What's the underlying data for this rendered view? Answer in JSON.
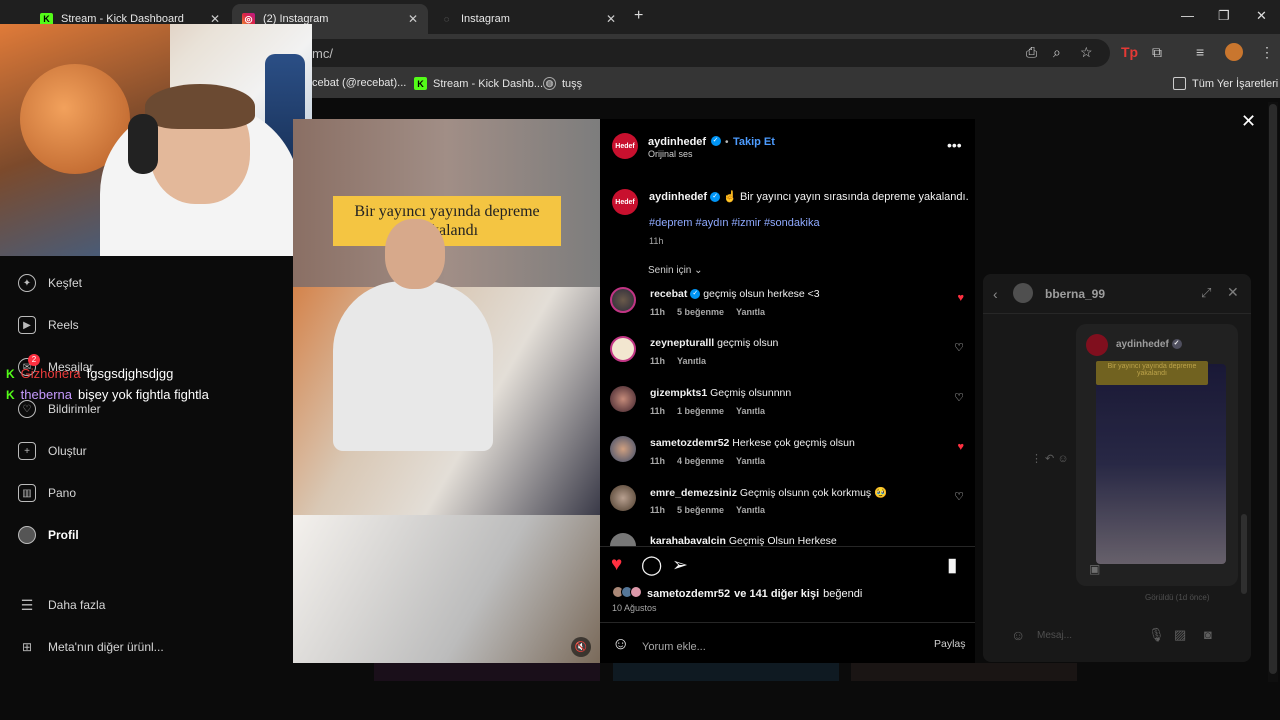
{
  "browser": {
    "tabs": [
      {
        "label": "Stream - Kick Dashboard",
        "favicon": "K"
      },
      {
        "label": "(2) Instagram",
        "favicon": "instagram-icon"
      },
      {
        "label": "Instagram",
        "favicon": "loading-icon"
      }
    ],
    "new_tab": "+",
    "url": "mc/",
    "bookmarks": [
      {
        "label": "cebat (@recebat)..."
      },
      {
        "label": "Stream - Kick Dashb..."
      },
      {
        "label": "tuşş"
      }
    ],
    "all_bookmarks": "Tüm Yer İşaretleri"
  },
  "nav": {
    "items": [
      {
        "label": "Keşfet",
        "icon": "compass-icon"
      },
      {
        "label": "Reels",
        "icon": "reels-icon"
      },
      {
        "label": "Mesajlar",
        "icon": "messenger-icon",
        "badge": "2"
      },
      {
        "label": "Bildirimler",
        "icon": "heart-icon"
      },
      {
        "label": "Oluştur",
        "icon": "plus-icon"
      },
      {
        "label": "Pano",
        "icon": "dashboard-icon"
      },
      {
        "label": "Profil",
        "icon": "profile-avatar"
      },
      {
        "label": "Daha fazla",
        "icon": "menu-icon"
      },
      {
        "label": "Meta'nın diğer ürünl...",
        "icon": "apps-icon"
      }
    ]
  },
  "chat": [
    {
      "user": "Gizhonera",
      "message": "fgsgsdjghsdjgg"
    },
    {
      "user": "theberna",
      "message": "bişey yok fightla fightla"
    }
  ],
  "video": {
    "caption": "Bir yayıncı yayında depreme yakalandı"
  },
  "post": {
    "author": "aydinhedef",
    "author_badge": "Hedef",
    "follow": "Takip Et",
    "audio": "Orijinal ses",
    "description_author": "aydinhedef",
    "description": "Bir yayıncı yayın sırasında depreme yakalandı.",
    "hashtags": "#deprem #aydın #izmir #sondakika",
    "time": "11h",
    "sort": "Senin için",
    "comments": [
      {
        "user": "recebat",
        "text": "geçmiş olsun herkese <3",
        "time": "11h",
        "likes": "5 beğenme",
        "reply": "Yanıtla",
        "liked": true
      },
      {
        "user": "zeynepturalll",
        "text": "geçmiş olsun",
        "time": "11h",
        "likes": "",
        "reply": "Yanıtla",
        "liked": false
      },
      {
        "user": "gizempkts1",
        "text": "Geçmiş olsunnnn",
        "time": "11h",
        "likes": "1 beğenme",
        "reply": "Yanıtla",
        "liked": false
      },
      {
        "user": "sametozdemr52",
        "text": "Herkese çok geçmiş olsun",
        "time": "11h",
        "likes": "4 beğenme",
        "reply": "Yanıtla",
        "liked": true
      },
      {
        "user": "emre_demezsiniz",
        "text": "Geçmiş olsunn çok korkmuş 🥹",
        "time": "11h",
        "likes": "5 beğenme",
        "reply": "Yanıtla",
        "liked": false
      },
      {
        "user": "karahabavalcin",
        "text": "Geçmiş Olsun Herkese",
        "time": "",
        "likes": "",
        "reply": "",
        "liked": false
      }
    ],
    "liked_by_user": "sametozdemr52",
    "liked_by_rest": "ve 141 diğer kişi",
    "liked_by_suffix": "beğendi",
    "date": "10 Ağustos",
    "comment_placeholder": "Yorum ekle...",
    "share": "Paylaş"
  },
  "dm": {
    "username": "bberna_99",
    "shared_author": "aydinhedef",
    "shared_caption": "Bir yayıncı yayında depreme yakalandı",
    "seen": "Görüldü (1d önce)",
    "input_placeholder": "Mesaj..."
  },
  "colors": {
    "kick_green": "#53fc18",
    "instagram_blue": "#0095f6",
    "like_red": "#ff3040",
    "caption_yellow": "#f4c542"
  }
}
